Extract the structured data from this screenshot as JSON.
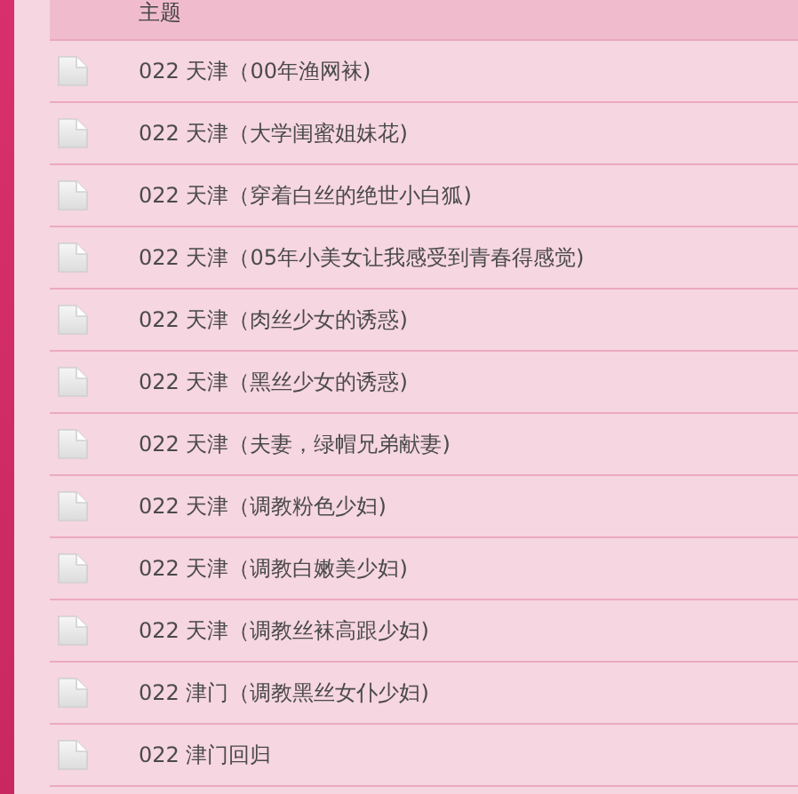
{
  "table": {
    "columns": [
      "主题"
    ],
    "rows": [
      {
        "title": "022 天津（00年渔网袜)"
      },
      {
        "title": "022 天津（大学闺蜜姐妹花)"
      },
      {
        "title": "022 天津（穿着白丝的绝世小白狐)"
      },
      {
        "title": "022 天津（05年小美女让我感受到青春得感觉)"
      },
      {
        "title": "022 天津（肉丝少女的诱惑)"
      },
      {
        "title": "022 天津（黑丝少女的诱惑)"
      },
      {
        "title": "022 天津（夫妻，绿帽兄弟献妻)"
      },
      {
        "title": "022 天津（调教粉色少妇)"
      },
      {
        "title": "022 天津（调教白嫩美少妇)"
      },
      {
        "title": "022 天津（调教丝袜高跟少妇)"
      },
      {
        "title": "022 津门（调教黑丝女仆少妇)"
      },
      {
        "title": "022 津门回归"
      }
    ]
  }
}
